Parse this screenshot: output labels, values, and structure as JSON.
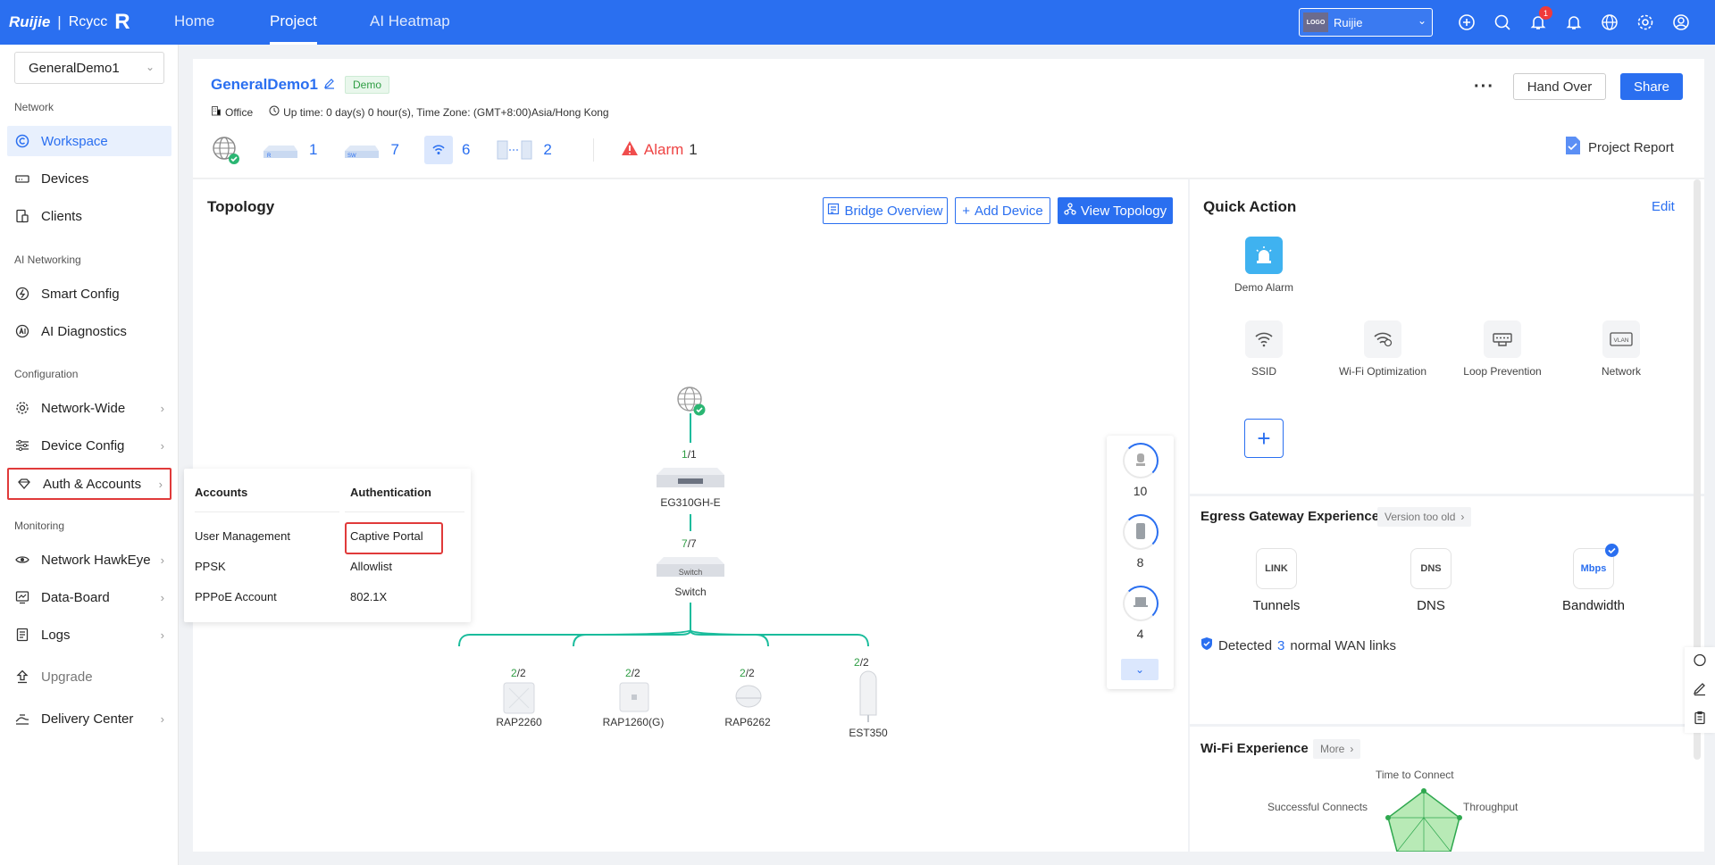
{
  "topbar": {
    "logo_brand": "Ruijie",
    "logo_separator": "|",
    "logo_brand2": "Rcycc",
    "logo_mark": "R",
    "tabs": [
      {
        "label": "Home",
        "active": false
      },
      {
        "label": "Project",
        "active": true
      },
      {
        "label": "AI Heatmap",
        "active": false
      }
    ],
    "org_logo_text": "LOGO",
    "org_name": "Ruijie",
    "notification_count": "1",
    "icons": [
      "add-circle-icon",
      "search-icon",
      "notification-icon",
      "bell-icon",
      "globe-icon",
      "settings-icon",
      "user-icon"
    ],
    "accent_color": "#2a6ff0"
  },
  "sidebar": {
    "project_select": "GeneralDemo1",
    "sections": {
      "network": "Network",
      "ai_networking": "AI Networking",
      "configuration": "Configuration",
      "monitoring": "Monitoring"
    },
    "items": {
      "workspace": "Workspace",
      "devices": "Devices",
      "clients": "Clients",
      "smart_config": "Smart Config",
      "ai_diagnostics": "AI Diagnostics",
      "network_wide": "Network-Wide",
      "device_config": "Device Config",
      "auth_accounts": "Auth & Accounts",
      "network_hawkeye": "Network HawkEye",
      "data_board": "Data-Board",
      "logs": "Logs",
      "upgrade": "Upgrade",
      "delivery_center": "Delivery Center"
    }
  },
  "flyout": {
    "accounts_header": "Accounts",
    "auth_header": "Authentication",
    "accounts": [
      "User Management",
      "PPSK",
      "PPPoE Account"
    ],
    "authentication": [
      "Captive Portal",
      "Allowlist",
      "802.1X"
    ]
  },
  "header": {
    "project_name": "GeneralDemo1",
    "tag": "Demo",
    "scene": "Office",
    "uptime": "Up time: 0 day(s) 0 hour(s), Time Zone: (GMT+8:00)Asia/Hong Kong",
    "counts": {
      "gateway": "1",
      "switch": "7",
      "ap": "6",
      "bridge": "2"
    },
    "alarm_label": "Alarm",
    "alarm_count": "1",
    "more": "···",
    "hand_over": "Hand Over",
    "share": "Share",
    "project_report": "Project Report"
  },
  "topology": {
    "title": "Topology",
    "bridge_overview": "Bridge Overview",
    "add_device": "Add Device",
    "view_topology": "View Topology",
    "gateway": {
      "count_green": "1",
      "count_rest": "/1",
      "label": "EG310GH-E"
    },
    "switch": {
      "count_green": "7",
      "count_rest": "/7",
      "label": "Switch",
      "face_text": "Switch"
    },
    "aps": [
      {
        "count_green": "2",
        "count_rest": "/2",
        "label": "RAP2260"
      },
      {
        "count_green": "2",
        "count_rest": "/2",
        "label": "RAP1260(G)"
      },
      {
        "count_green": "2",
        "count_rest": "/2",
        "label": "RAP6262"
      },
      {
        "count_green": "2",
        "count_rest": "/2",
        "label": "EST350"
      }
    ],
    "side_counts": [
      "10",
      "8",
      "4"
    ]
  },
  "quick_action": {
    "title": "Quick Action",
    "edit": "Edit",
    "items": [
      "Demo Alarm",
      "SSID",
      "Wi-Fi Optimization",
      "Loop Prevention",
      "Network"
    ],
    "vlan_text": "VLAN",
    "add": "+"
  },
  "egress": {
    "title": "Egress Gateway Experience",
    "version_pill": "Version too old",
    "items": [
      "Tunnels",
      "DNS",
      "Bandwidth"
    ],
    "icon_texts": [
      "LINK",
      "DNS",
      "Mbps"
    ],
    "detected_prefix": "Detected",
    "detected_count": "3",
    "detected_suffix": "normal WAN links"
  },
  "wifi": {
    "title": "Wi-Fi Experience",
    "more": "More",
    "radar_labels": [
      "Time to Connect",
      "Successful Connects",
      "Throughput"
    ]
  }
}
